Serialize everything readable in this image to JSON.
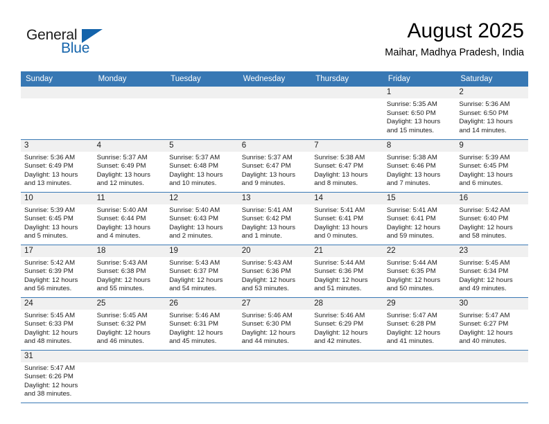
{
  "brand": {
    "name_part1": "General",
    "name_part2": "Blue",
    "accent_color": "#1464ab"
  },
  "header": {
    "month_title": "August 2025",
    "location": "Maihar, Madhya Pradesh, India"
  },
  "theme": {
    "header_blue": "#3878b4",
    "daynum_strip": "#f0f0f0",
    "text": "#1c1c1c"
  },
  "weekdays": [
    "Sunday",
    "Monday",
    "Tuesday",
    "Wednesday",
    "Thursday",
    "Friday",
    "Saturday"
  ],
  "labels": {
    "sunrise_prefix": "Sunrise: ",
    "sunset_prefix": "Sunset: ",
    "daylight_prefix": "Daylight: "
  },
  "weeks": [
    [
      {
        "empty": true
      },
      {
        "empty": true
      },
      {
        "empty": true
      },
      {
        "empty": true
      },
      {
        "empty": true
      },
      {
        "day": "1",
        "sunrise": "Sunrise: 5:35 AM",
        "sunset": "Sunset: 6:50 PM",
        "daylight": "Daylight: 13 hours and 15 minutes."
      },
      {
        "day": "2",
        "sunrise": "Sunrise: 5:36 AM",
        "sunset": "Sunset: 6:50 PM",
        "daylight": "Daylight: 13 hours and 14 minutes."
      }
    ],
    [
      {
        "day": "3",
        "sunrise": "Sunrise: 5:36 AM",
        "sunset": "Sunset: 6:49 PM",
        "daylight": "Daylight: 13 hours and 13 minutes."
      },
      {
        "day": "4",
        "sunrise": "Sunrise: 5:37 AM",
        "sunset": "Sunset: 6:49 PM",
        "daylight": "Daylight: 13 hours and 12 minutes."
      },
      {
        "day": "5",
        "sunrise": "Sunrise: 5:37 AM",
        "sunset": "Sunset: 6:48 PM",
        "daylight": "Daylight: 13 hours and 10 minutes."
      },
      {
        "day": "6",
        "sunrise": "Sunrise: 5:37 AM",
        "sunset": "Sunset: 6:47 PM",
        "daylight": "Daylight: 13 hours and 9 minutes."
      },
      {
        "day": "7",
        "sunrise": "Sunrise: 5:38 AM",
        "sunset": "Sunset: 6:47 PM",
        "daylight": "Daylight: 13 hours and 8 minutes."
      },
      {
        "day": "8",
        "sunrise": "Sunrise: 5:38 AM",
        "sunset": "Sunset: 6:46 PM",
        "daylight": "Daylight: 13 hours and 7 minutes."
      },
      {
        "day": "9",
        "sunrise": "Sunrise: 5:39 AM",
        "sunset": "Sunset: 6:45 PM",
        "daylight": "Daylight: 13 hours and 6 minutes."
      }
    ],
    [
      {
        "day": "10",
        "sunrise": "Sunrise: 5:39 AM",
        "sunset": "Sunset: 6:45 PM",
        "daylight": "Daylight: 13 hours and 5 minutes."
      },
      {
        "day": "11",
        "sunrise": "Sunrise: 5:40 AM",
        "sunset": "Sunset: 6:44 PM",
        "daylight": "Daylight: 13 hours and 4 minutes."
      },
      {
        "day": "12",
        "sunrise": "Sunrise: 5:40 AM",
        "sunset": "Sunset: 6:43 PM",
        "daylight": "Daylight: 13 hours and 2 minutes."
      },
      {
        "day": "13",
        "sunrise": "Sunrise: 5:41 AM",
        "sunset": "Sunset: 6:42 PM",
        "daylight": "Daylight: 13 hours and 1 minute."
      },
      {
        "day": "14",
        "sunrise": "Sunrise: 5:41 AM",
        "sunset": "Sunset: 6:41 PM",
        "daylight": "Daylight: 13 hours and 0 minutes."
      },
      {
        "day": "15",
        "sunrise": "Sunrise: 5:41 AM",
        "sunset": "Sunset: 6:41 PM",
        "daylight": "Daylight: 12 hours and 59 minutes."
      },
      {
        "day": "16",
        "sunrise": "Sunrise: 5:42 AM",
        "sunset": "Sunset: 6:40 PM",
        "daylight": "Daylight: 12 hours and 58 minutes."
      }
    ],
    [
      {
        "day": "17",
        "sunrise": "Sunrise: 5:42 AM",
        "sunset": "Sunset: 6:39 PM",
        "daylight": "Daylight: 12 hours and 56 minutes."
      },
      {
        "day": "18",
        "sunrise": "Sunrise: 5:43 AM",
        "sunset": "Sunset: 6:38 PM",
        "daylight": "Daylight: 12 hours and 55 minutes."
      },
      {
        "day": "19",
        "sunrise": "Sunrise: 5:43 AM",
        "sunset": "Sunset: 6:37 PM",
        "daylight": "Daylight: 12 hours and 54 minutes."
      },
      {
        "day": "20",
        "sunrise": "Sunrise: 5:43 AM",
        "sunset": "Sunset: 6:36 PM",
        "daylight": "Daylight: 12 hours and 53 minutes."
      },
      {
        "day": "21",
        "sunrise": "Sunrise: 5:44 AM",
        "sunset": "Sunset: 6:36 PM",
        "daylight": "Daylight: 12 hours and 51 minutes."
      },
      {
        "day": "22",
        "sunrise": "Sunrise: 5:44 AM",
        "sunset": "Sunset: 6:35 PM",
        "daylight": "Daylight: 12 hours and 50 minutes."
      },
      {
        "day": "23",
        "sunrise": "Sunrise: 5:45 AM",
        "sunset": "Sunset: 6:34 PM",
        "daylight": "Daylight: 12 hours and 49 minutes."
      }
    ],
    [
      {
        "day": "24",
        "sunrise": "Sunrise: 5:45 AM",
        "sunset": "Sunset: 6:33 PM",
        "daylight": "Daylight: 12 hours and 48 minutes."
      },
      {
        "day": "25",
        "sunrise": "Sunrise: 5:45 AM",
        "sunset": "Sunset: 6:32 PM",
        "daylight": "Daylight: 12 hours and 46 minutes."
      },
      {
        "day": "26",
        "sunrise": "Sunrise: 5:46 AM",
        "sunset": "Sunset: 6:31 PM",
        "daylight": "Daylight: 12 hours and 45 minutes."
      },
      {
        "day": "27",
        "sunrise": "Sunrise: 5:46 AM",
        "sunset": "Sunset: 6:30 PM",
        "daylight": "Daylight: 12 hours and 44 minutes."
      },
      {
        "day": "28",
        "sunrise": "Sunrise: 5:46 AM",
        "sunset": "Sunset: 6:29 PM",
        "daylight": "Daylight: 12 hours and 42 minutes."
      },
      {
        "day": "29",
        "sunrise": "Sunrise: 5:47 AM",
        "sunset": "Sunset: 6:28 PM",
        "daylight": "Daylight: 12 hours and 41 minutes."
      },
      {
        "day": "30",
        "sunrise": "Sunrise: 5:47 AM",
        "sunset": "Sunset: 6:27 PM",
        "daylight": "Daylight: 12 hours and 40 minutes."
      }
    ],
    [
      {
        "day": "31",
        "sunrise": "Sunrise: 5:47 AM",
        "sunset": "Sunset: 6:26 PM",
        "daylight": "Daylight: 12 hours and 38 minutes."
      },
      {
        "empty": true
      },
      {
        "empty": true
      },
      {
        "empty": true
      },
      {
        "empty": true
      },
      {
        "empty": true
      },
      {
        "empty": true
      }
    ]
  ]
}
